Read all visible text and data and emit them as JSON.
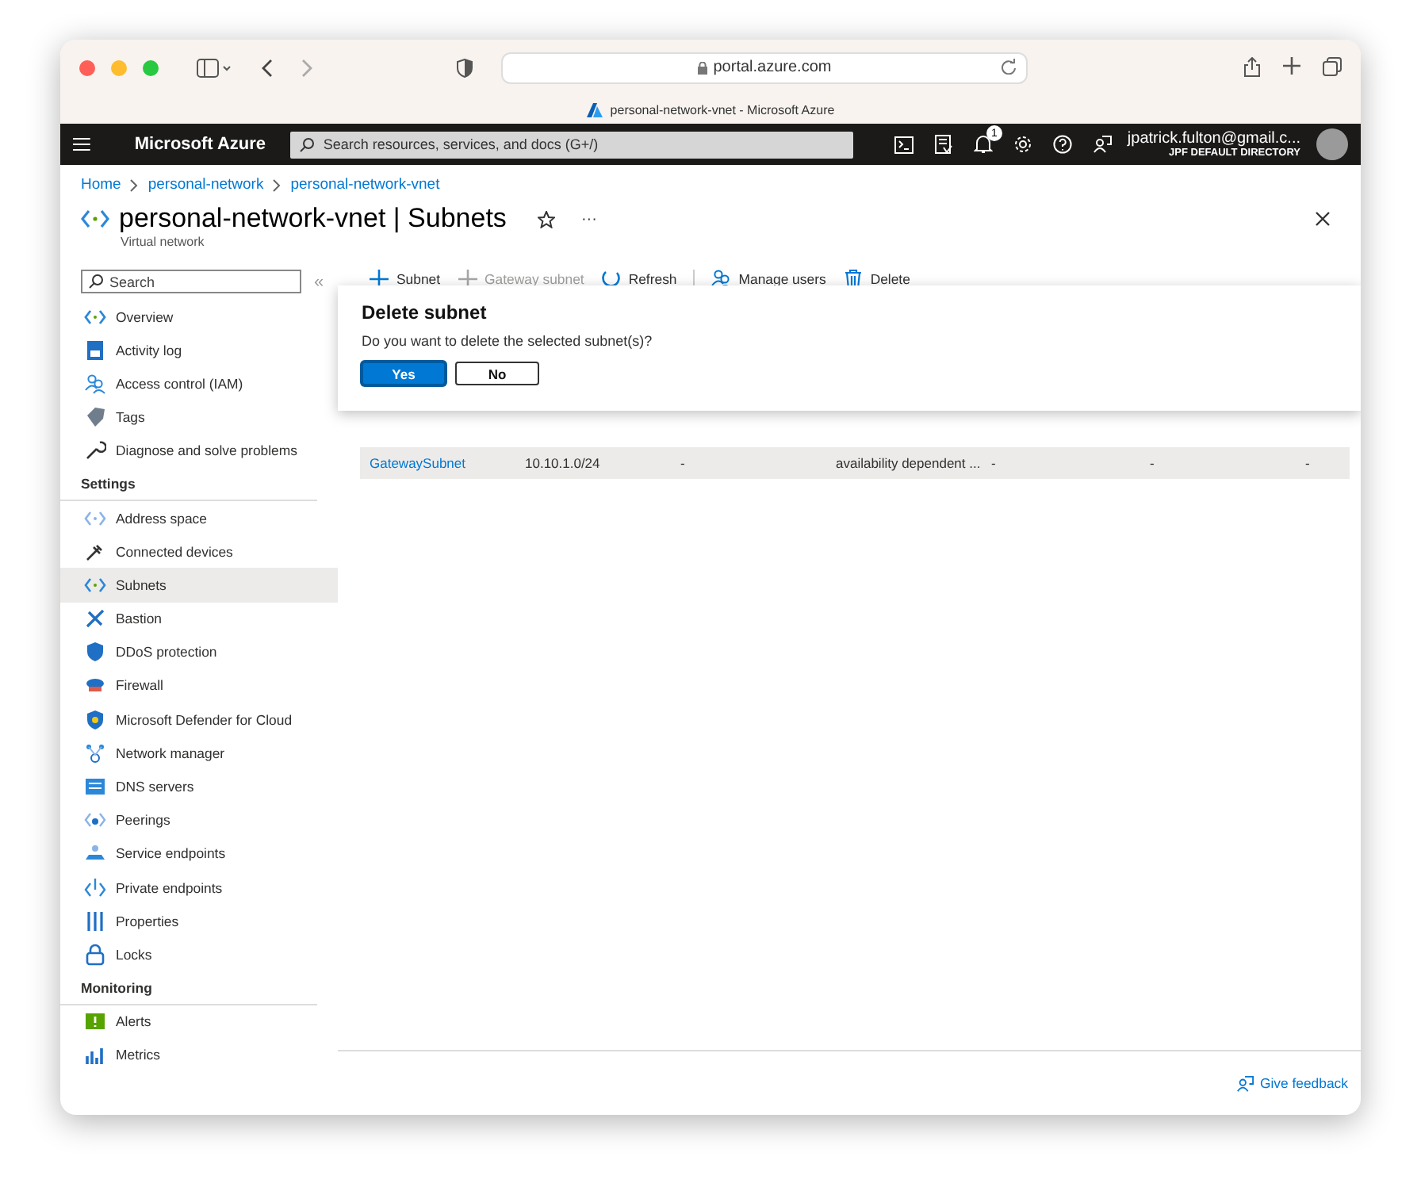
{
  "browser": {
    "address": "portal.azure.com",
    "tab_title": "personal-network-vnet - Microsoft Azure"
  },
  "topbar": {
    "brand": "Microsoft Azure",
    "search": {
      "placeholder": "Search resources, services, and docs (G+/)"
    },
    "notification_count": "1",
    "account": "jpatrick.fulton@gmail.c...",
    "directory": "JPF DEFAULT DIRECTORY"
  },
  "breadcrumb": [
    "Home",
    "personal-network",
    "personal-network-vnet"
  ],
  "header": {
    "title": "personal-network-vnet | Subnets",
    "subtitle": "Virtual network",
    "more": "···"
  },
  "sidebar": {
    "search": {
      "placeholder": "Search"
    },
    "collapse": "«",
    "items": [
      {
        "kind": "item",
        "label": "Overview",
        "selected": false
      },
      {
        "kind": "item",
        "label": "Activity log",
        "selected": false
      },
      {
        "kind": "item",
        "label": "Access control (IAM)",
        "selected": false
      },
      {
        "kind": "item",
        "label": "Tags",
        "selected": false
      },
      {
        "kind": "item",
        "label": "Diagnose and solve problems",
        "selected": false
      },
      {
        "kind": "heading",
        "label": "Settings"
      },
      {
        "kind": "item",
        "label": "Address space",
        "selected": false
      },
      {
        "kind": "item",
        "label": "Connected devices",
        "selected": false
      },
      {
        "kind": "item",
        "label": "Subnets",
        "selected": true
      },
      {
        "kind": "item",
        "label": "Bastion",
        "selected": false
      },
      {
        "kind": "item",
        "label": "DDoS protection",
        "selected": false
      },
      {
        "kind": "item",
        "label": "Firewall",
        "selected": false
      },
      {
        "kind": "item",
        "label": "Microsoft Defender for Cloud",
        "selected": false
      },
      {
        "kind": "item",
        "label": "Network manager",
        "selected": false
      },
      {
        "kind": "item",
        "label": "DNS servers",
        "selected": false
      },
      {
        "kind": "item",
        "label": "Peerings",
        "selected": false
      },
      {
        "kind": "item",
        "label": "Service endpoints",
        "selected": false
      },
      {
        "kind": "item",
        "label": "Private endpoints",
        "selected": false
      },
      {
        "kind": "item",
        "label": "Properties",
        "selected": false
      },
      {
        "kind": "item",
        "label": "Locks",
        "selected": false
      },
      {
        "kind": "heading",
        "label": "Monitoring"
      },
      {
        "kind": "item",
        "label": "Alerts",
        "selected": false
      },
      {
        "kind": "item",
        "label": "Metrics",
        "selected": false
      }
    ]
  },
  "toolbar": [
    {
      "label": "Subnet",
      "disabled": false
    },
    {
      "label": "Gateway subnet",
      "disabled": true
    },
    {
      "label": "Refresh",
      "disabled": false
    },
    {
      "label": "Manage users",
      "disabled": false
    },
    {
      "label": "Delete",
      "disabled": false
    }
  ],
  "dialog": {
    "title": "Delete subnet",
    "message": "Do you want to delete the selected subnet(s)?",
    "buttons": [
      {
        "label": "Yes",
        "primary": true
      },
      {
        "label": "No",
        "primary": false
      }
    ]
  },
  "table": {
    "rows": [
      {
        "selected": true,
        "cells": [
          "GatewaySubnet",
          "10.10.1.0/24",
          "-",
          "availability dependent ...",
          "-",
          "-",
          "-"
        ]
      }
    ]
  },
  "footer": {
    "feedback": "Give feedback"
  }
}
